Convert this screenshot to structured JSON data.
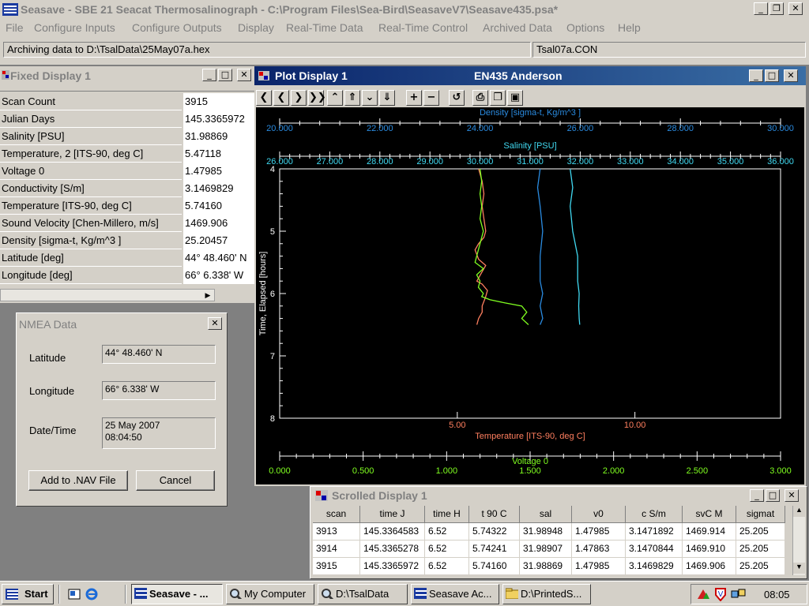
{
  "window": {
    "title": "Seasave - SBE 21 Seacat Thermosalinograph - C:\\Program Files\\Sea-Bird\\SeasaveV7\\Seasave435.psa*"
  },
  "menu": [
    "File",
    "Configure Inputs",
    "Configure Outputs",
    "Display",
    "Real-Time Data",
    "Real-Time Control",
    "Archived Data",
    "Options",
    "Help"
  ],
  "status": {
    "archive": "Archiving data to D:\\TsalData\\25May07a.hex",
    "config": "Tsal07a.CON"
  },
  "fixed_display": {
    "title": "Fixed Display 1",
    "rows": [
      {
        "label": "Scan Count",
        "value": "3915"
      },
      {
        "label": "Julian Days",
        "value": "145.3365972"
      },
      {
        "label": "Salinity [PSU]",
        "value": "31.98869"
      },
      {
        "label": "Temperature, 2 [ITS-90, deg C]",
        "value": "5.47118"
      },
      {
        "label": "Voltage 0",
        "value": "1.47985"
      },
      {
        "label": "Conductivity [S/m]",
        "value": "3.1469829"
      },
      {
        "label": "Temperature [ITS-90, deg C]",
        "value": "5.74160"
      },
      {
        "label": "Sound Velocity [Chen-Millero, m/s]",
        "value": "1469.906"
      },
      {
        "label": "Density [sigma-t, Kg/m^3 ]",
        "value": "25.20457"
      },
      {
        "label": "Latitude [deg]",
        "value": " 44° 48.460' N"
      },
      {
        "label": "Longitude [deg]",
        "value": " 66°  6.338' W"
      }
    ]
  },
  "nmea": {
    "title": "NMEA Data",
    "latitude_label": "Latitude",
    "latitude": "44° 48.460' N",
    "longitude_label": "Longitude",
    "longitude": "66°  6.338' W",
    "datetime_label": "Date/Time",
    "date": "25 May 2007",
    "time": "08:04:50",
    "add_button": "Add to .NAV File",
    "cancel_button": "Cancel"
  },
  "plot": {
    "title": "Plot Display 1",
    "subtitle": "EN435 Anderson",
    "toolbar": [
      "first-icon",
      "prev-icon",
      "next-icon",
      "last-icon",
      "up-icon",
      "page-up-icon",
      "down-icon",
      "page-down-icon",
      "zoom-in-icon",
      "zoom-out-icon",
      "undo-icon",
      "print-icon",
      "copy-icon",
      "save-icon"
    ],
    "colors": {
      "bg": "#000000",
      "temperature": "#ff7f5f",
      "voltage": "#80ff20",
      "density": "#2a8be0",
      "salinity": "#40d8f0"
    }
  },
  "chart_data": {
    "type": "line",
    "ylabel": "Time, Elapsed [hours]",
    "ylim": [
      4,
      8
    ],
    "y_ticks": [
      "4",
      "5",
      "6",
      "7",
      "8"
    ],
    "axes": [
      {
        "name": "Density [sigma-t, Kg/m^3 ]",
        "position": "top",
        "range": [
          20,
          30
        ],
        "ticks": [
          "20.000",
          "22.000",
          "24.000",
          "26.000",
          "28.000",
          "30.000"
        ],
        "color": "#2a8be0"
      },
      {
        "name": "Salinity [PSU]",
        "position": "top",
        "range": [
          26,
          36
        ],
        "ticks": [
          "26.000",
          "27.000",
          "28.000",
          "29.000",
          "30.000",
          "31.000",
          "32.000",
          "33.000",
          "34.000",
          "35.000",
          "36.000"
        ],
        "color": "#40d8f0"
      },
      {
        "name": "Temperature [ITS-90, deg C]",
        "position": "bottom",
        "range": [
          0,
          14.1
        ],
        "ticks": [
          "5.00",
          "10.00"
        ],
        "tick_values": [
          5,
          10
        ],
        "color": "#ff7f5f"
      },
      {
        "name": "Voltage 0",
        "position": "bottom",
        "range": [
          0,
          3
        ],
        "ticks": [
          "0.000",
          "0.500",
          "1.000",
          "1.500",
          "2.000",
          "2.500",
          "3.000"
        ],
        "color": "#80ff20"
      }
    ],
    "series": [
      {
        "axis": 2,
        "y": [
          4.0,
          4.2,
          4.4,
          4.6,
          4.8,
          5.0,
          5.1,
          5.2,
          5.3,
          5.45,
          5.55,
          5.7,
          5.8,
          5.85,
          5.95,
          6.05,
          6.2,
          6.3,
          6.4,
          6.5
        ],
        "values": [
          5.6,
          5.7,
          5.75,
          5.7,
          5.75,
          5.8,
          5.75,
          5.6,
          5.5,
          5.6,
          5.8,
          5.65,
          5.55,
          5.7,
          5.85,
          5.8,
          5.7,
          5.7,
          5.6,
          5.55
        ]
      },
      {
        "axis": 3,
        "y": [
          4.0,
          4.2,
          4.4,
          4.6,
          4.8,
          5.0,
          5.2,
          5.4,
          5.5,
          5.6,
          5.7,
          5.8,
          5.9,
          6.0,
          6.05,
          6.1,
          6.15,
          6.2,
          6.3,
          6.4,
          6.5
        ],
        "values": [
          1.2,
          1.21,
          1.2,
          1.21,
          1.2,
          1.22,
          1.2,
          1.18,
          1.17,
          1.22,
          1.18,
          1.2,
          1.19,
          1.22,
          1.21,
          1.26,
          1.35,
          1.45,
          1.48,
          1.45,
          1.49
        ]
      },
      {
        "axis": 0,
        "y": [
          4.0,
          4.3,
          4.6,
          5.0,
          5.4,
          5.8,
          6.0,
          6.2,
          6.4,
          6.5
        ],
        "values": [
          25.2,
          25.15,
          25.2,
          25.25,
          25.2,
          25.2,
          25.25,
          25.2,
          25.25,
          25.2
        ]
      },
      {
        "axis": 1,
        "y": [
          4.0,
          4.3,
          4.6,
          5.0,
          5.4,
          5.8,
          6.0,
          6.2,
          6.4,
          6.5
        ],
        "values": [
          31.8,
          31.85,
          31.8,
          31.85,
          31.95,
          31.95,
          31.98,
          31.97,
          31.98,
          31.99
        ]
      }
    ]
  },
  "scrolled": {
    "title": "Scrolled Display 1",
    "columns": [
      "scan",
      "time J",
      "time H",
      "t 90 C",
      "sal",
      "v0",
      "c S/m",
      "svC M",
      "sigmat"
    ],
    "rows": [
      [
        "3913",
        "145.3364583",
        "6.52",
        "5.74322",
        "31.98948",
        "1.47985",
        "3.1471892",
        "1469.914",
        "25.205"
      ],
      [
        "3914",
        "145.3365278",
        "6.52",
        "5.74241",
        "31.98907",
        "1.47863",
        "3.1470844",
        "1469.910",
        "25.205"
      ],
      [
        "3915",
        "145.3365972",
        "6.52",
        "5.74160",
        "31.98869",
        "1.47985",
        "3.1469829",
        "1469.906",
        "25.205"
      ]
    ]
  },
  "taskbar": {
    "start": "Start",
    "tasks": [
      "Seasave - ...",
      "My Computer",
      "D:\\TsalData",
      "Seasave Ac...",
      "D:\\PrintedS..."
    ],
    "clock": "08:05"
  }
}
